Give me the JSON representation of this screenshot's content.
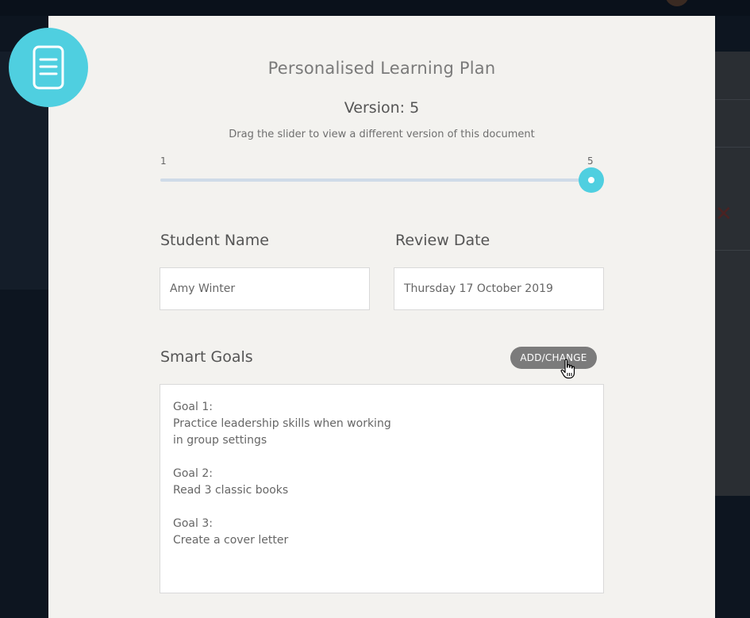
{
  "modal": {
    "title": "Personalised Learning Plan",
    "version_label": "Version:",
    "version_value": "5",
    "slider_hint": "Drag the slider to view a different version of this document",
    "slider": {
      "min_label": "1",
      "max_label": "5",
      "min": 1,
      "max": 5,
      "value": 5
    }
  },
  "fields": {
    "student_name_label": "Student Name",
    "student_name_value": "Amy Winter",
    "review_date_label": "Review Date",
    "review_date_value": "Thursday 17 October 2019"
  },
  "goals": {
    "section_label": "Smart Goals",
    "add_button": "ADD/CHANGE",
    "items": [
      {
        "heading": "Goal 1:",
        "text": "Practice leadership skills when working in group settings"
      },
      {
        "heading": "Goal 2:",
        "text": "Read 3 classic books"
      },
      {
        "heading": "Goal 3:",
        "text": "Create a cover letter"
      }
    ]
  },
  "colors": {
    "accent": "#4fcfe0",
    "modal_bg": "#f3f2ef",
    "button_bg": "#7b7b7b",
    "backdrop": "#0d1520"
  },
  "icons": {
    "badge": "document-icon",
    "cursor": "hand-pointer-icon"
  }
}
